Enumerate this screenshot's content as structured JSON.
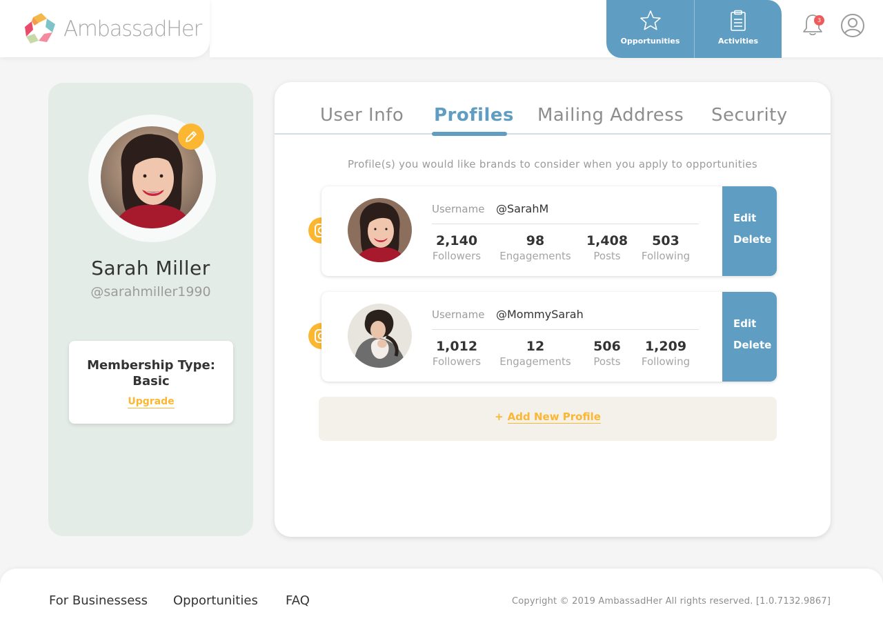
{
  "brand": {
    "name": "AmbassadHer"
  },
  "header": {
    "nav": [
      {
        "label": "Opportunities",
        "icon": "star-icon"
      },
      {
        "label": "Activities",
        "icon": "clipboard-icon"
      }
    ],
    "notification_count": "3"
  },
  "user": {
    "name": "Sarah Miller",
    "handle": "@sarahmiller1990",
    "membership_label": "Membership Type: Basic",
    "upgrade_label": "Upgrade"
  },
  "tabs": [
    {
      "label": "User Info"
    },
    {
      "label": "Profiles"
    },
    {
      "label": "Mailing Address"
    },
    {
      "label": "Security"
    }
  ],
  "active_tab": "Profiles",
  "profiles_intro": "Profile(s) you would like brands to consider when you apply to opportunities",
  "profiles": [
    {
      "platform": "instagram-icon",
      "username_label": "Username",
      "username": "@SarahM",
      "stats": [
        {
          "value": "2,140",
          "label": "Followers"
        },
        {
          "value": "98",
          "label": "Engagements"
        },
        {
          "value": "1,408",
          "label": "Posts"
        },
        {
          "value": "503",
          "label": "Following"
        }
      ],
      "edit_label": "Edit",
      "delete_label": "Delete"
    },
    {
      "platform": "instagram-icon",
      "username_label": "Username",
      "username": "@MommySarah",
      "stats": [
        {
          "value": "1,012",
          "label": "Followers"
        },
        {
          "value": "12",
          "label": "Engagements"
        },
        {
          "value": "506",
          "label": "Posts"
        },
        {
          "value": "1,209",
          "label": "Following"
        }
      ],
      "edit_label": "Edit",
      "delete_label": "Delete"
    }
  ],
  "add_profile": {
    "plus": "+",
    "label": "Add New Profile"
  },
  "footer": {
    "links": [
      "For Businessess",
      "Opportunities",
      "FAQ"
    ],
    "copyright": "Copyright © 2019 AmbassadHer All rights reserved. [1.0.7132.9867]"
  },
  "colors": {
    "accent_blue": "#5f9ec2",
    "accent_yellow": "#fbb731",
    "card_green": "#e4ece8",
    "badge_red": "#ef5b5b"
  }
}
